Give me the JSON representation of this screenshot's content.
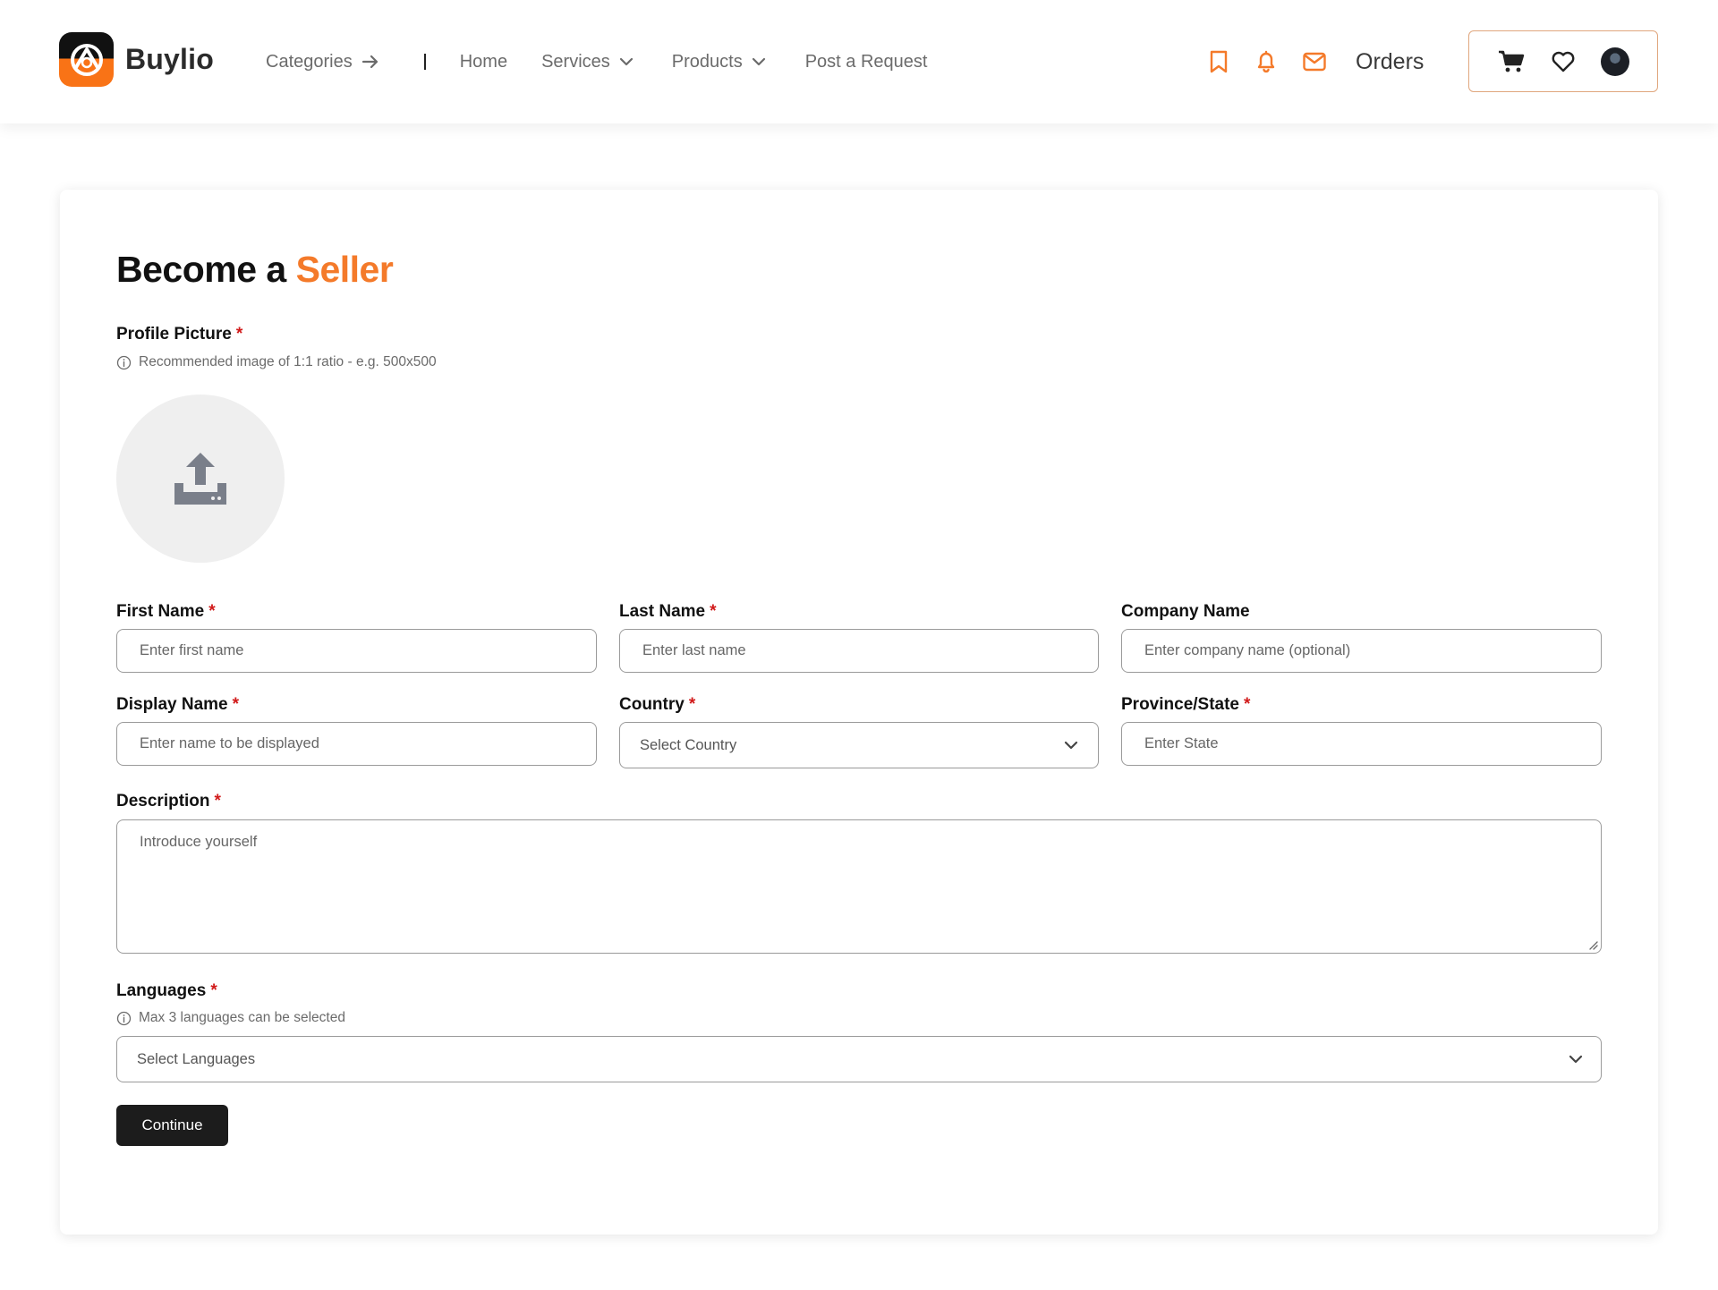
{
  "header": {
    "brand_name": "Buylio",
    "nav": {
      "categories": "Categories",
      "home": "Home",
      "services": "Services",
      "products": "Products",
      "post_request": "Post a Request"
    },
    "orders_label": "Orders"
  },
  "form": {
    "title_prefix": "Become a",
    "title_accent": "Seller",
    "required_marker": "*",
    "profile_picture": {
      "label": "Profile Picture",
      "hint": "Recommended image of 1:1 ratio - e.g. 500x500"
    },
    "first_name": {
      "label": "First Name",
      "placeholder": "Enter first name"
    },
    "last_name": {
      "label": "Last Name",
      "placeholder": "Enter last name"
    },
    "company_name": {
      "label": "Company Name",
      "placeholder": "Enter company name (optional)"
    },
    "display_name": {
      "label": "Display Name",
      "placeholder": "Enter name to be displayed"
    },
    "country": {
      "label": "Country",
      "value": "Select Country"
    },
    "province": {
      "label": "Province/State",
      "placeholder": "Enter State"
    },
    "description": {
      "label": "Description",
      "placeholder": "Introduce yourself"
    },
    "languages": {
      "label": "Languages",
      "hint": "Max 3 languages can be selected",
      "value": "Select Languages"
    },
    "continue_label": "Continue"
  },
  "colors": {
    "accent": "#f47a2a",
    "required": "#d11a1a",
    "button_bg": "#1c1c1c",
    "user_box_border": "#e0a77e"
  },
  "icons": {
    "categories_arrow": "arrow-right-icon",
    "dropdown": "chevron-down-icon",
    "header": [
      "bookmark-icon",
      "bell-icon",
      "mail-icon"
    ],
    "user_box": [
      "cart-icon",
      "heart-icon",
      "avatar"
    ],
    "upload": "upload-icon",
    "hint": "info-icon"
  }
}
